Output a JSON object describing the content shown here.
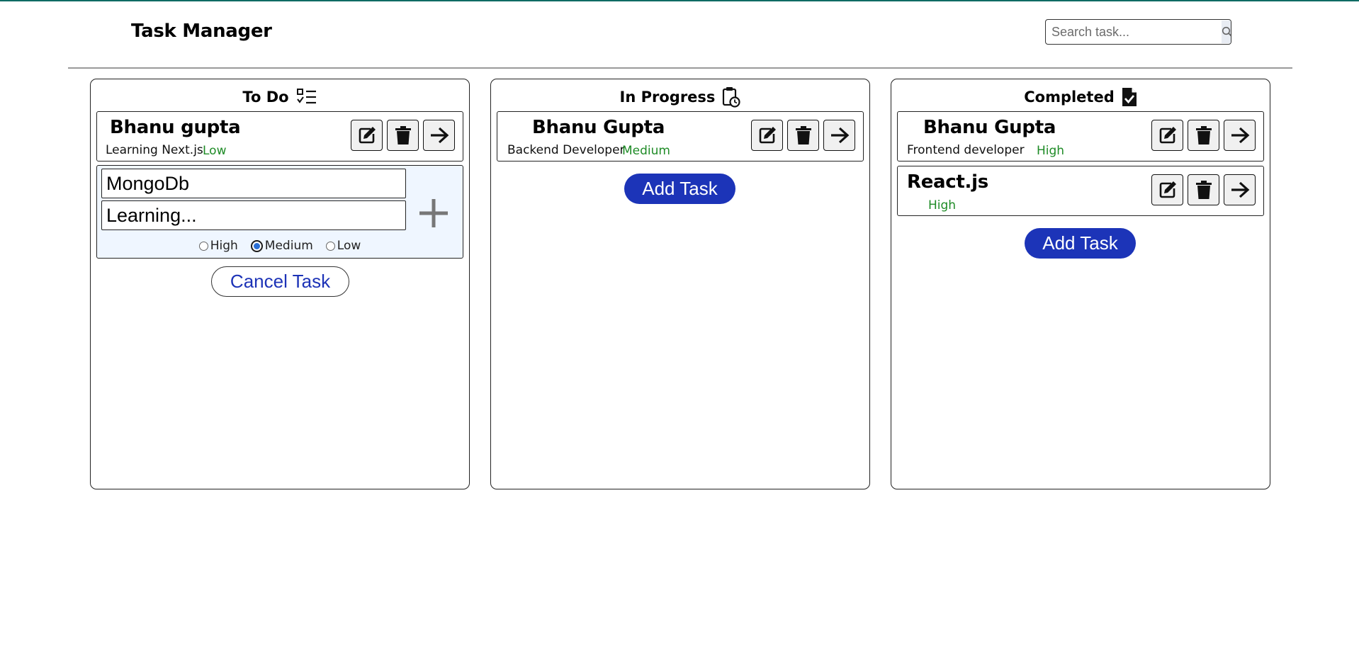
{
  "app": {
    "title": "Task Manager"
  },
  "search": {
    "placeholder": "Search task..."
  },
  "columns": {
    "todo": {
      "title": "To Do",
      "tasks": [
        {
          "title": "Bhanu gupta",
          "description": "Learning Next.js",
          "priority": "Low"
        }
      ],
      "form": {
        "title_value": "MongoDb",
        "description_value": "Learning...",
        "priority_options": [
          "High",
          "Medium",
          "Low"
        ],
        "selected_priority": "Medium"
      },
      "cancel_label": "Cancel Task"
    },
    "in_progress": {
      "title": "In Progress",
      "tasks": [
        {
          "title": "Bhanu Gupta",
          "description": "Backend Developer",
          "priority": "Medium"
        }
      ],
      "add_label": "Add Task"
    },
    "completed": {
      "title": "Completed",
      "tasks": [
        {
          "title": "Bhanu Gupta",
          "description": "Frontend developer",
          "priority": "High"
        },
        {
          "title": "React.js",
          "description": "",
          "priority": "High"
        }
      ],
      "add_label": "Add Task"
    }
  },
  "colors": {
    "accent": "#1c34b8",
    "priority_text": "#1e8b26",
    "top_border": "#0f6b63",
    "form_background": "#eff6ff"
  },
  "icons": {
    "todo_header": "checklist-icon",
    "in_progress_header": "clipboard-clock-icon",
    "completed_header": "file-check-icon",
    "search": "search-icon",
    "edit": "edit-icon",
    "delete": "trash-icon",
    "move": "arrow-right-icon",
    "add": "plus-icon"
  }
}
